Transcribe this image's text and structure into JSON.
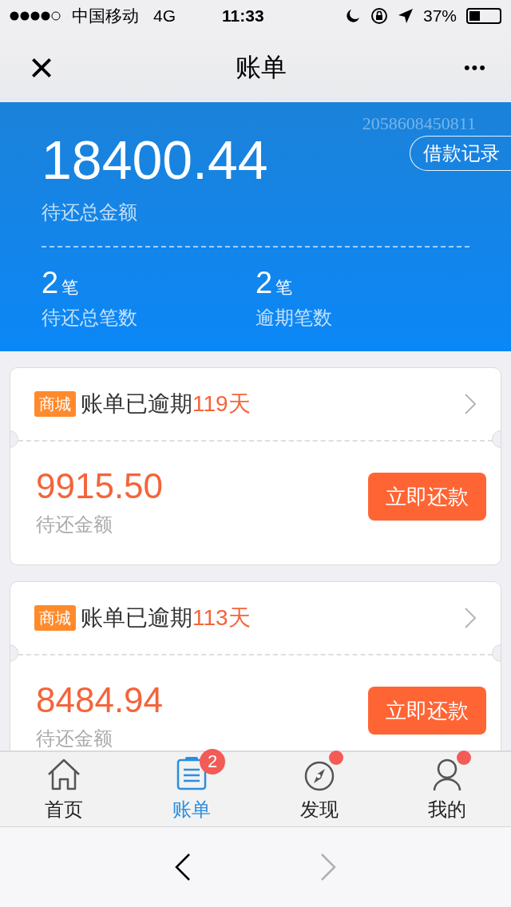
{
  "status_bar": {
    "carrier": "中国移动",
    "network": "4G",
    "time": "11:33",
    "battery": "37%"
  },
  "nav": {
    "close": "×",
    "title": "账单",
    "more": "•••"
  },
  "summary": {
    "id_text": "2058608450811",
    "record_button": "借款记录",
    "total": "18400.44",
    "total_label": "待还总金额",
    "stats": [
      {
        "value": "2",
        "unit": "笔",
        "label": "待还总笔数"
      },
      {
        "value": "2",
        "unit": "笔",
        "label": "逾期笔数"
      }
    ]
  },
  "bills": [
    {
      "tag": "商城",
      "title": "账单已逾期",
      "days": "119天",
      "amount": "9915.50",
      "amount_label": "待还金额",
      "pay_button": "立即还款"
    },
    {
      "tag": "商城",
      "title": "账单已逾期",
      "days": "113天",
      "amount": "8484.94",
      "amount_label": "待还金额",
      "pay_button": "立即还款"
    }
  ],
  "tab_bar": [
    {
      "kind": "home",
      "label": "首页",
      "selected": false
    },
    {
      "kind": "bill",
      "label": "账单",
      "selected": true,
      "badge": "2"
    },
    {
      "kind": "discover",
      "label": "发现",
      "selected": false,
      "dot": true
    },
    {
      "kind": "me",
      "label": "我的",
      "selected": false,
      "dot": true
    }
  ],
  "browser_bar": {
    "back_enabled": true,
    "forward_enabled": false
  }
}
